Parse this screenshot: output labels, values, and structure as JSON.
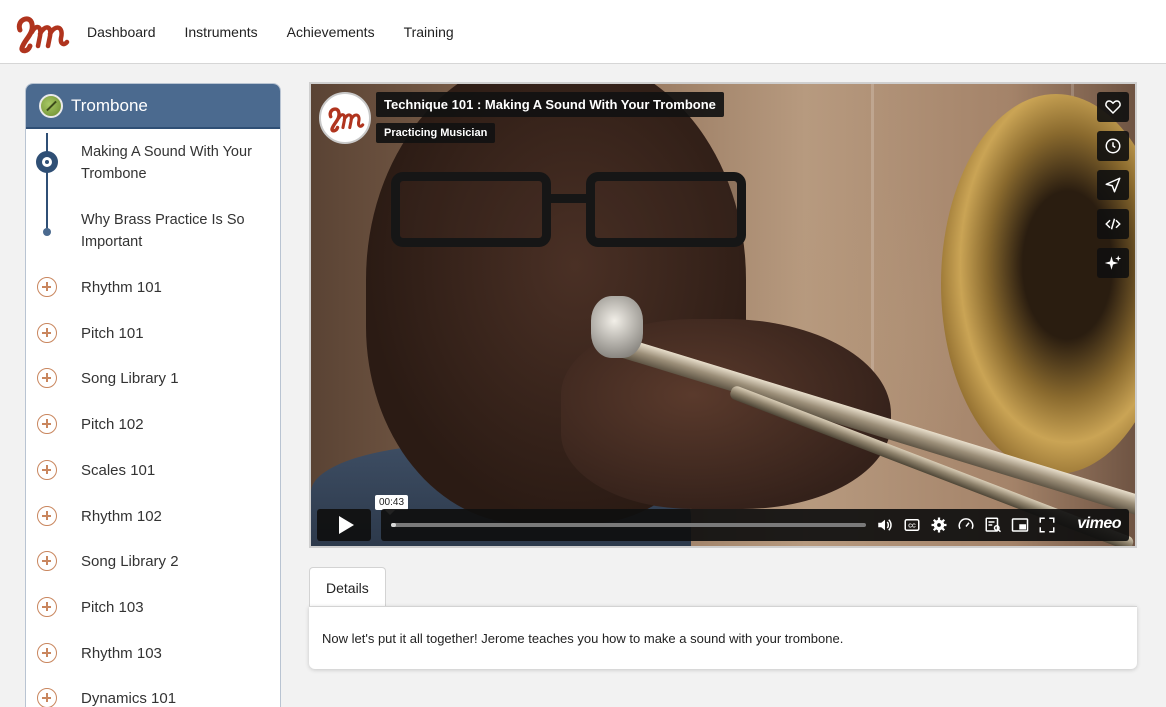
{
  "nav": {
    "items": [
      "Dashboard",
      "Instruments",
      "Achievements",
      "Training"
    ]
  },
  "sidebar": {
    "instrument": "Trombone",
    "lessons": [
      {
        "label": "Making A Sound With Your Trombone",
        "active": true
      },
      {
        "label": "Why Brass Practice Is So Important",
        "active": false
      }
    ],
    "modules": [
      "Rhythm 101",
      "Pitch 101",
      "Song Library 1",
      "Pitch 102",
      "Scales 101",
      "Rhythm 102",
      "Song Library 2",
      "Pitch 103",
      "Rhythm 103",
      "Dynamics 101"
    ]
  },
  "video": {
    "title": "Technique 101 : Making A Sound With Your Trombone",
    "channel": "Practicing Musician",
    "timecode": "00:43",
    "progress": 0.01,
    "player_brand": "vimeo",
    "side_buttons": [
      "heart-icon",
      "clock-icon",
      "send-icon",
      "embed-code-icon",
      "sparkle-icon"
    ],
    "control_icons": [
      "volume-icon",
      "cc-icon",
      "settings-icon",
      "speed-icon",
      "transcript-icon",
      "pip-icon",
      "fullscreen-icon"
    ]
  },
  "details": {
    "tab_label": "Details",
    "description": "Now let's put it all together! Jerome teaches you how to make a sound with your trombone."
  },
  "colors": {
    "accent_blue": "#4b6a8f",
    "accent_dark_blue": "#2f4f75",
    "plus_icon": "#c9865e",
    "logo_red": "#b0341e"
  }
}
